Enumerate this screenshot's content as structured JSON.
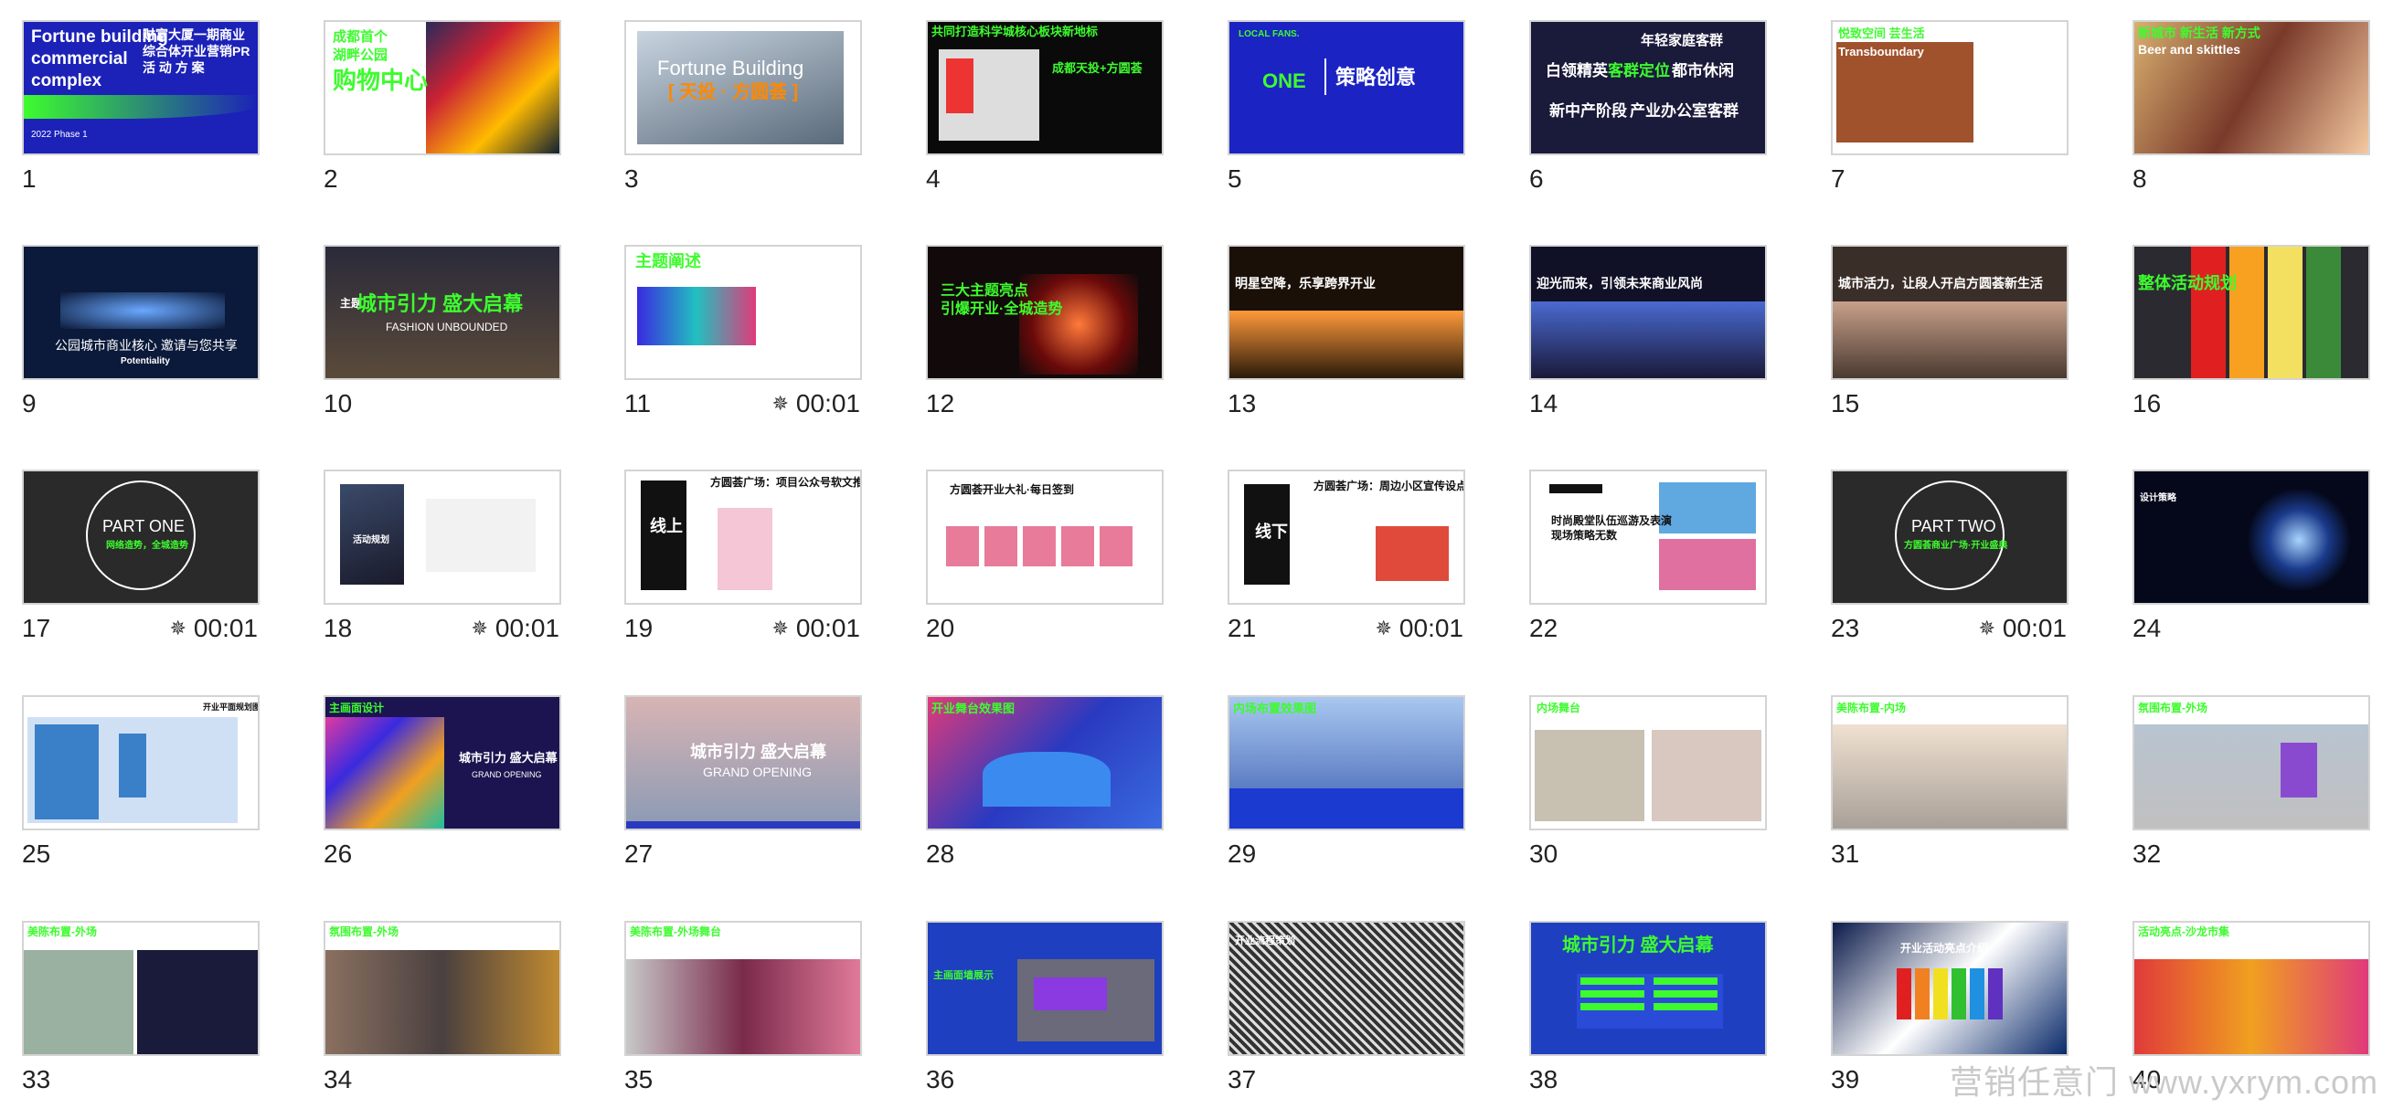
{
  "watermark": "营销任意门 www.yxrym.com",
  "timing_label": "00:01",
  "slides": [
    {
      "n": "1",
      "bg": "#1c22b8",
      "texts": [
        "Fortune building",
        "commercial",
        "complex",
        "财富大厦一期商业",
        "综合体开业营销PR",
        "活 动 方 案",
        "2022 Phase 1"
      ],
      "timing": false
    },
    {
      "n": "2",
      "bg": "#ffffff",
      "texts": [
        "成都首个",
        "湖畔公园",
        "购物中心"
      ],
      "timing": false
    },
    {
      "n": "3",
      "bg": "#ffffff",
      "texts": [
        "Fortune Building",
        "[ 天投 · 方圆荟 ]"
      ],
      "timing": false
    },
    {
      "n": "4",
      "bg": "#0a0a0a",
      "texts": [
        "共同打造科学城核心板块新地标",
        "成都天投+方圆荟"
      ],
      "timing": false
    },
    {
      "n": "5",
      "bg": "#1b24c2",
      "texts": [
        "LOCAL FANS.",
        "ONE",
        "策略创意"
      ],
      "timing": false
    },
    {
      "n": "6",
      "bg": "#1a1a3a",
      "texts": [
        "年轻家庭客群",
        "白领精英",
        "客群定位",
        "都市休闲",
        "新中产阶段",
        "产业办公室客群"
      ],
      "timing": false
    },
    {
      "n": "7",
      "bg": "#ffffff",
      "texts": [
        "悦致空间 芸生活",
        "Transboundary"
      ],
      "timing": false
    },
    {
      "n": "8",
      "bg": "#6b4a2e",
      "texts": [
        "新城市 新生活 新方式",
        "Beer and skittles"
      ],
      "timing": false
    },
    {
      "n": "9",
      "bg": "#0b1a3a",
      "texts": [
        "公园城市商业核心 邀请与您共享",
        "Potentiality"
      ],
      "timing": false
    },
    {
      "n": "10",
      "bg": "#1c1c22",
      "texts": [
        "主题",
        "城市引力 盛大启幕",
        "FASHION UNBOUNDED"
      ],
      "timing": false
    },
    {
      "n": "11",
      "bg": "#ffffff",
      "texts": [
        "主题阐述"
      ],
      "timing": true
    },
    {
      "n": "12",
      "bg": "#120a0a",
      "texts": [
        "三大主题亮点",
        "引爆开业·全城造势"
      ],
      "timing": false
    },
    {
      "n": "13",
      "bg": "#1a1008",
      "texts": [
        "明星空降，乐享跨界开业"
      ],
      "timing": false
    },
    {
      "n": "14",
      "bg": "#101026",
      "texts": [
        "迎光而来，引领未来商业风尚"
      ],
      "timing": false
    },
    {
      "n": "15",
      "bg": "#3a2e28",
      "texts": [
        "城市活力，让段人开启方圆荟新生活"
      ],
      "timing": false
    },
    {
      "n": "16",
      "bg": "#2a2a30",
      "texts": [
        "整体活动规划"
      ],
      "timing": false
    },
    {
      "n": "17",
      "bg": "#2a2a2a",
      "texts": [
        "PART ONE",
        "网络造势，全城造势"
      ],
      "timing": true
    },
    {
      "n": "18",
      "bg": "#ffffff",
      "texts": [
        "活动规划"
      ],
      "timing": true
    },
    {
      "n": "19",
      "bg": "#ffffff",
      "texts": [
        "方圆荟广场：项目公众号软文推广",
        "线上"
      ],
      "timing": true
    },
    {
      "n": "20",
      "bg": "#ffffff",
      "texts": [
        "方圆荟开业大礼·每日签到"
      ],
      "timing": false
    },
    {
      "n": "21",
      "bg": "#ffffff",
      "texts": [
        "方圆荟广场：周边小区宣传设点",
        "线下"
      ],
      "timing": true
    },
    {
      "n": "22",
      "bg": "#ffffff",
      "texts": [
        "时尚殿堂队伍巡游及表演",
        "现场策略无数"
      ],
      "timing": false
    },
    {
      "n": "23",
      "bg": "#2a2a2a",
      "texts": [
        "PART TWO",
        "方圆荟商业广场·开业盛典"
      ],
      "timing": true
    },
    {
      "n": "24",
      "bg": "#04081a",
      "texts": [
        "设计策略"
      ],
      "timing": false
    },
    {
      "n": "25",
      "bg": "#ffffff",
      "texts": [
        "开业平面规划图"
      ],
      "timing": false
    },
    {
      "n": "26",
      "bg": "#1c1450",
      "texts": [
        "主画面设计",
        "城市引力 盛大启幕",
        "GRAND OPENING"
      ],
      "timing": false
    },
    {
      "n": "27",
      "bg": "#a8b4c4",
      "texts": [
        "城市引力 盛大启幕",
        "GRAND OPENING"
      ],
      "timing": false
    },
    {
      "n": "28",
      "bg": "#2a2a8a",
      "texts": [
        "开业舞台效果图"
      ],
      "timing": false
    },
    {
      "n": "29",
      "bg": "#6a8ac8",
      "texts": [
        "内场布置效果图"
      ],
      "timing": false
    },
    {
      "n": "30",
      "bg": "#ffffff",
      "texts": [
        "内场舞台"
      ],
      "timing": false
    },
    {
      "n": "31",
      "bg": "#ffffff",
      "texts": [
        "美陈布置-内场"
      ],
      "timing": false
    },
    {
      "n": "32",
      "bg": "#ffffff",
      "texts": [
        "氛围布置-外场"
      ],
      "timing": false
    },
    {
      "n": "33",
      "bg": "#ffffff",
      "texts": [
        "美陈布置-外场"
      ],
      "timing": false
    },
    {
      "n": "34",
      "bg": "#ffffff",
      "texts": [
        "氛围布置-外场"
      ],
      "timing": false
    },
    {
      "n": "35",
      "bg": "#ffffff",
      "texts": [
        "美陈布置-外场舞台"
      ],
      "timing": false
    },
    {
      "n": "36",
      "bg": "#1e3fc0",
      "texts": [
        "主画面墙展示"
      ],
      "timing": false
    },
    {
      "n": "37",
      "bg": "#303030",
      "texts": [
        "开业流程策划"
      ],
      "timing": false
    },
    {
      "n": "38",
      "bg": "#1e3fc0",
      "texts": [
        "城市引力 盛大启幕"
      ],
      "timing": false
    },
    {
      "n": "39",
      "bg": "#0a1a4a",
      "texts": [
        "开业活动亮点介绍"
      ],
      "timing": false
    },
    {
      "n": "40",
      "bg": "#ffffff",
      "texts": [
        "活动亮点-沙龙市集"
      ],
      "timing": false
    }
  ]
}
